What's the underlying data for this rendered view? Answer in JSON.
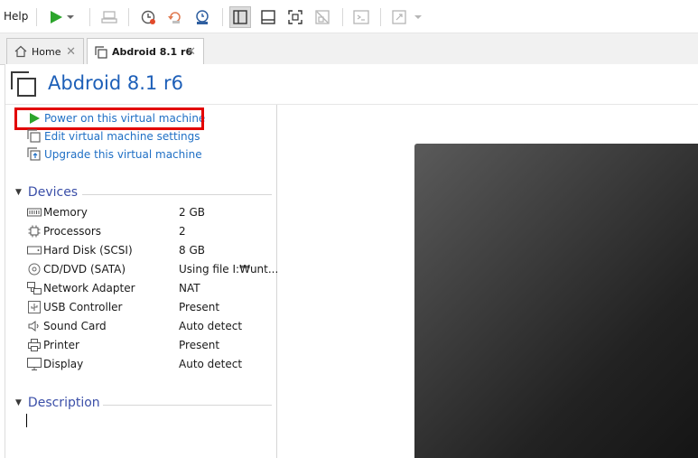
{
  "menu": {
    "help": "Help"
  },
  "tabs": [
    {
      "label": "Home"
    },
    {
      "label": "Abdroid 8.1 r6"
    }
  ],
  "vm": {
    "title": "Abdroid 8.1 r6"
  },
  "actions": {
    "power_on": "Power on this virtual machine",
    "edit_settings": "Edit virtual machine settings",
    "upgrade": "Upgrade this virtual machine"
  },
  "devices": {
    "heading": "Devices",
    "items": [
      {
        "name": "Memory",
        "value": "2 GB",
        "icon": "memory-icon"
      },
      {
        "name": "Processors",
        "value": "2",
        "icon": "processor-icon"
      },
      {
        "name": "Hard Disk (SCSI)",
        "value": "8 GB",
        "icon": "hard-disk-icon"
      },
      {
        "name": "CD/DVD (SATA)",
        "value": "Using file I:₩unt...",
        "icon": "cd-dvd-icon"
      },
      {
        "name": "Network Adapter",
        "value": "NAT",
        "icon": "network-adapter-icon"
      },
      {
        "name": "USB Controller",
        "value": "Present",
        "icon": "usb-controller-icon"
      },
      {
        "name": "Sound Card",
        "value": "Auto detect",
        "icon": "sound-card-icon"
      },
      {
        "name": "Printer",
        "value": "Present",
        "icon": "printer-icon"
      },
      {
        "name": "Display",
        "value": "Auto detect",
        "icon": "display-icon"
      }
    ]
  },
  "description": {
    "heading": "Description"
  },
  "colors": {
    "accent": "#1f6fc5",
    "highlight": "#e20000",
    "play": "#2ca52c",
    "section": "#3b4fa8"
  }
}
